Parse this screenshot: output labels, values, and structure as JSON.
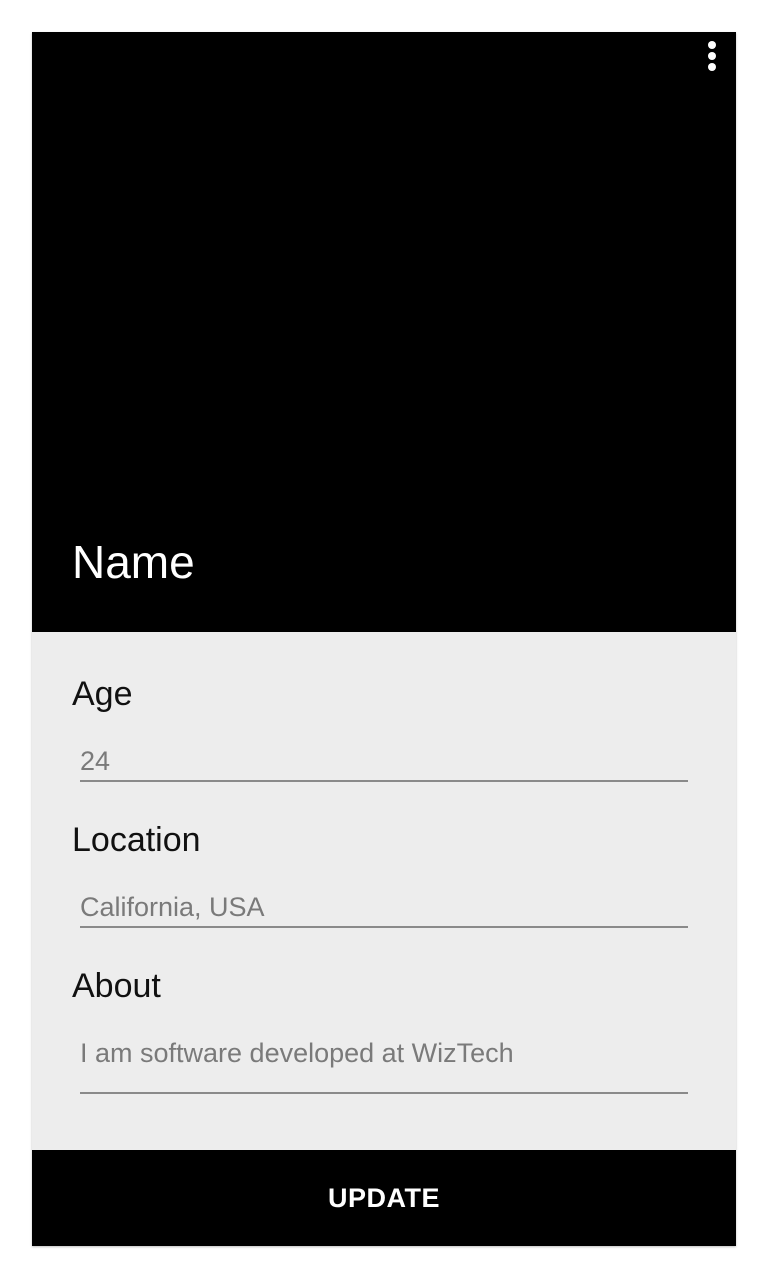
{
  "header": {
    "name": "Name",
    "menu_icon": "more-vert-icon"
  },
  "form": {
    "age_label": "Age",
    "age_value": "24",
    "location_label": "Location",
    "location_value": "California, USA",
    "about_label": "About",
    "about_value": "I am software developed at WizTech"
  },
  "actions": {
    "update_label": "UPDATE"
  },
  "colors": {
    "header_bg": "#000000",
    "card_bg": "#ededed",
    "button_bg": "#000000"
  }
}
